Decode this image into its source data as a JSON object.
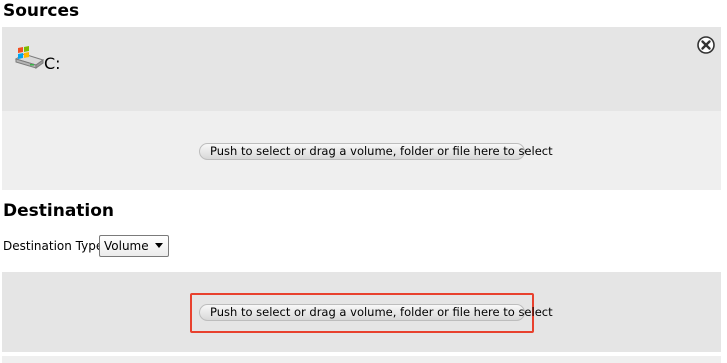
{
  "sources": {
    "title": "Sources",
    "items": [
      {
        "label": "C:",
        "icon": "windows-drive-icon"
      }
    ],
    "select_button_label": "Push to select or drag a volume, folder or file here to select"
  },
  "destination": {
    "title": "Destination",
    "type_label": "Destination Type:",
    "type_selected": "Volume",
    "select_button_label": "Push to select or drag a volume, folder or file here to select"
  },
  "colors": {
    "panel_gray": "#e5e5e5",
    "panel_light": "#efefef",
    "highlight": "#e8412e"
  }
}
